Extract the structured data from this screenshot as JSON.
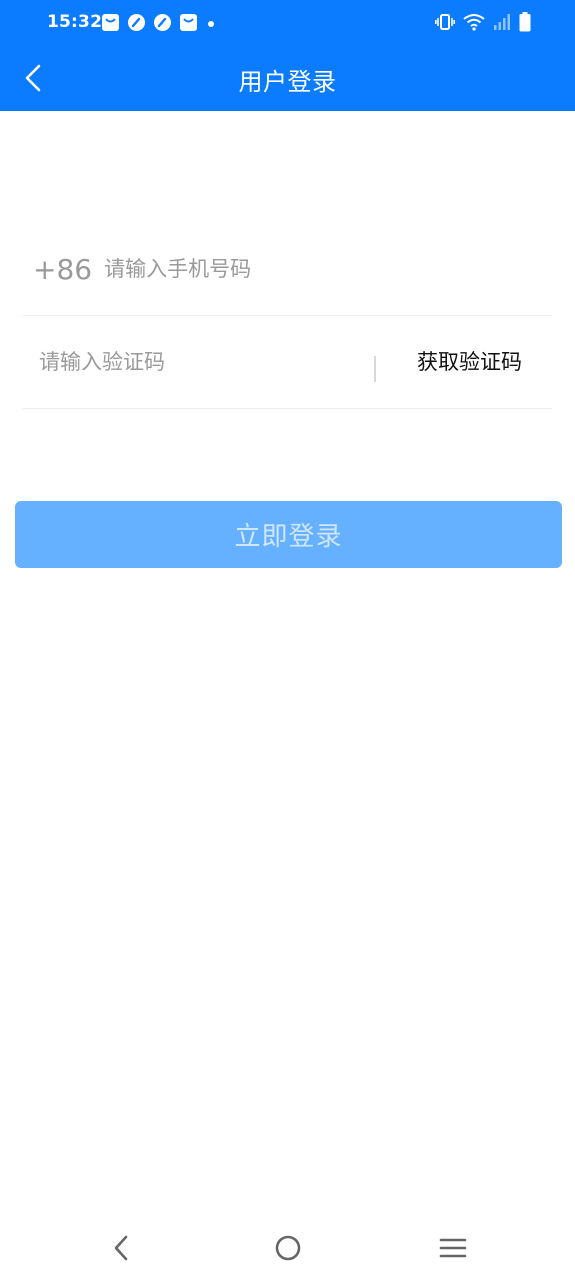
{
  "status_bar": {
    "time": "15:32",
    "left_icons": [
      "bag-icon",
      "speed-icon",
      "speed-icon",
      "bag-icon",
      "dot-icon"
    ],
    "right_icons": [
      "vibrate-icon",
      "wifi-icon",
      "signal-icon",
      "battery-icon"
    ]
  },
  "header": {
    "title": "用户登录",
    "background": "#0b7cff"
  },
  "form": {
    "country_code": "+86",
    "phone_placeholder": "请输入手机号码",
    "phone_value": "",
    "code_placeholder": "请输入验证码",
    "code_value": "",
    "get_code_label": "获取验证码"
  },
  "login_button": {
    "label": "立即登录",
    "color": "#66b1ff"
  },
  "navbar": {
    "buttons": [
      "back-icon",
      "home-icon",
      "menu-icon"
    ]
  }
}
